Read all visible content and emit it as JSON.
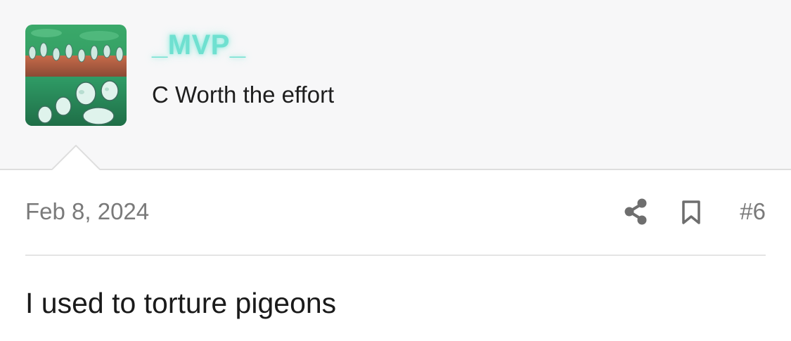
{
  "author": {
    "username": "_MVP_",
    "title": "C Worth the effort",
    "avatar_icon": "green-armored-figures-avatar",
    "username_color": "#6fe0d0"
  },
  "post": {
    "date": "Feb 8, 2024",
    "number": "#6",
    "body": "I used to torture pigeons"
  },
  "actions": {
    "share_icon": "share-icon",
    "bookmark_icon": "bookmark-icon"
  }
}
